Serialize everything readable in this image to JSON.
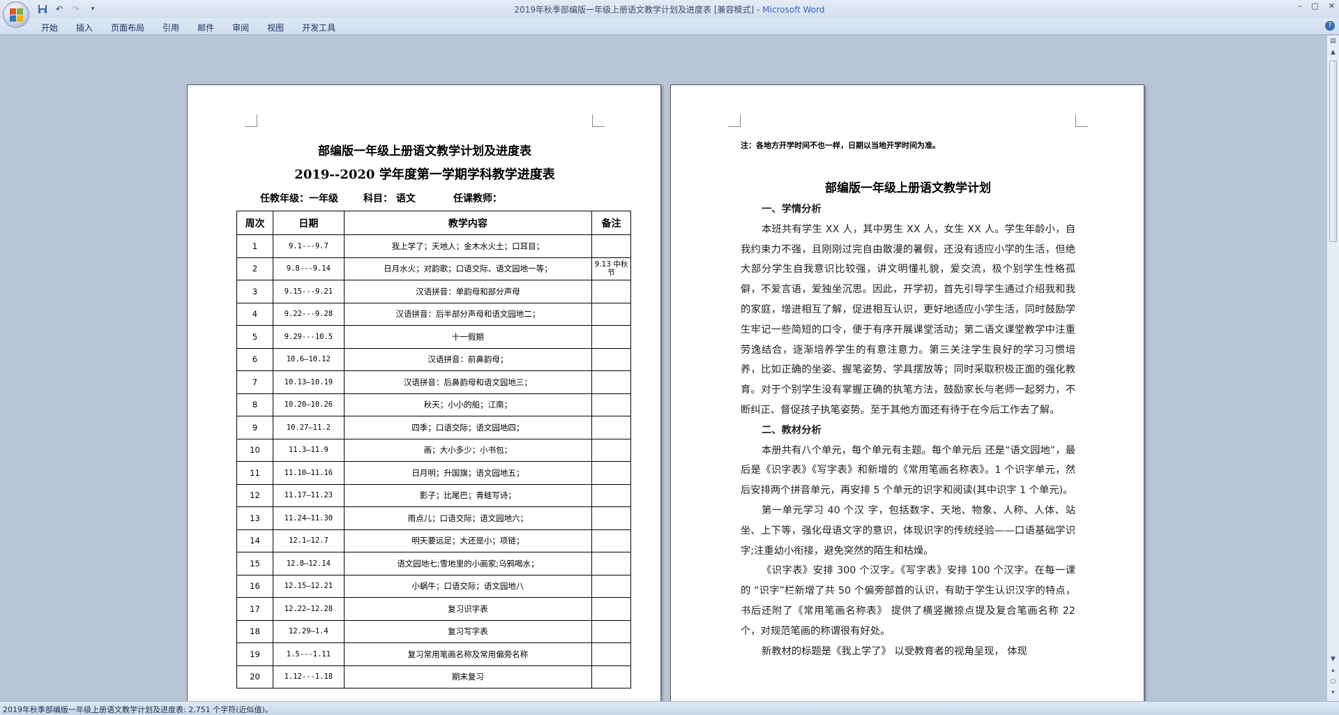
{
  "window": {
    "title": "2019年秋季部编版一年级上册语文教学计划及进度表 [兼容模式]",
    "app_name": "Microsoft Word",
    "controls": [
      "–",
      "□",
      "✕"
    ]
  },
  "ribbon": {
    "tabs": [
      "开始",
      "插入",
      "页面布局",
      "引用",
      "邮件",
      "审阅",
      "视图",
      "开发工具"
    ],
    "help": "?"
  },
  "page1": {
    "title": "部编版一年级上册语文教学计划及进度表",
    "subtitle": "2019--2020 学年度第一学期学科教学进度表",
    "info": {
      "grade": "任教年级：一年级",
      "subject": "科目： 语文",
      "teacher": "任课教师："
    },
    "table": {
      "headers": [
        "周次",
        "日期",
        "教学内容",
        "备注"
      ],
      "rows": [
        {
          "week": "1",
          "date": "9.1---9.7",
          "content": "我上学了；天地人；金木水火土；口耳目；",
          "remark": ""
        },
        {
          "week": "2",
          "date": "9.8---9.14",
          "content": "日月水火；对韵歌；口语交际、语文园地一等；",
          "remark": "9.13 中秋节"
        },
        {
          "week": "3",
          "date": "9.15---9.21",
          "content": "汉语拼音：单韵母和部分声母",
          "remark": ""
        },
        {
          "week": "4",
          "date": "9.22---9.28",
          "content": "汉语拼音：后半部分声母和语文园地二；",
          "remark": ""
        },
        {
          "week": "5",
          "date": "9.29---10.5",
          "content": "十一假期",
          "remark": ""
        },
        {
          "week": "6",
          "date": "10.6—10.12",
          "content": "汉语拼音：前鼻韵母；",
          "remark": ""
        },
        {
          "week": "7",
          "date": "10.13—10.19",
          "content": "汉语拼音：后鼻韵母和语文园地三；",
          "remark": ""
        },
        {
          "week": "8",
          "date": "10.20—10.26",
          "content": "秋天；小小的船；江南；",
          "remark": ""
        },
        {
          "week": "9",
          "date": "10.27—11.2",
          "content": "四季；口语交际；语文园地四；",
          "remark": ""
        },
        {
          "week": "10",
          "date": "11.3—11.9",
          "content": "画；大小多少；小书包；",
          "remark": ""
        },
        {
          "week": "11",
          "date": "11.10—11.16",
          "content": "日月明；升国旗；语文园地五；",
          "remark": ""
        },
        {
          "week": "12",
          "date": "11.17—11.23",
          "content": "影子；比尾巴；青蛙写诗；",
          "remark": ""
        },
        {
          "week": "13",
          "date": "11.24—11.30",
          "content": "雨点儿；口语交际；语文园地六；",
          "remark": ""
        },
        {
          "week": "14",
          "date": "12.1—12.7",
          "content": "明天要远足；大还是小；项链；",
          "remark": ""
        },
        {
          "week": "15",
          "date": "12.8—12.14",
          "content": "语文园地七;雪地里的小画家;乌鸦喝水；",
          "remark": ""
        },
        {
          "week": "16",
          "date": "12.15—12.21",
          "content": "小蜗牛；口语交际；语文园地八",
          "remark": ""
        },
        {
          "week": "17",
          "date": "12.22—12.28",
          "content": "复习识字表",
          "remark": ""
        },
        {
          "week": "18",
          "date": "12.29—1.4",
          "content": "复习写字表",
          "remark": ""
        },
        {
          "week": "19",
          "date": "1.5---1.11",
          "content": "复习常用笔画名称及常用偏旁名称",
          "remark": ""
        },
        {
          "week": "20",
          "date": "1.12---1.18",
          "content": "期末复习",
          "remark": ""
        }
      ]
    }
  },
  "page2": {
    "note": "注：各地方开学时间不也一样，日期以当地开学时间为准。",
    "title": "部编版一年级上册语文教学计划",
    "sections": [
      {
        "type": "heading",
        "text": "一、学情分析"
      },
      {
        "type": "para",
        "text": "本班共有学生 XX 人，其中男生 XX 人，女生 XX 人。学生年龄小，自我约束力不强，且刚刚过完自由散漫的暑假，还没有适应小学的生活，但绝大部分学生自我意识比较强，讲文明懂礼貌，爱交流，极个别学生性格孤僻，不爱言语，爱独坐沉思。因此，开学初，首先引导学生通过介绍我和我的家庭，增进相互了解，促进相互认识，更好地适应小学生活，同时鼓励学生牢记一些简短的口令，便于有序开展课堂活动；第二语文课堂教学中注重劳逸结合，逐渐培养学生的有意注意力。第三关注学生良好的学习习惯培养，比如正确的坐姿、握笔姿势、学具摆放等；同时采取积极正面的强化教育。对于个别学生没有掌握正确的执笔方法，鼓励家长与老师一起努力，不断纠正、督促孩子执笔姿势。至于其他方面还有待于在今后工作去了解。"
      },
      {
        "type": "heading",
        "text": "二、教材分析"
      },
      {
        "type": "para",
        "text": "本册共有八个单元，每个单元有主题。每个单元后 还是“语文园地”，最后是《识字表》《写字表》和新增的《常用笔画名称表》。1 个识字单元，然后安排两个拼音单元，再安排 5 个单元的识字和阅读(其中识字 1 个单元)。"
      },
      {
        "type": "para",
        "text": "第一单元学习 40 个汉 字，包括数字、天地、物象、人称、人体、站坐、上下等，强化母语文字的意识，体现识字的传统经验——口语基础学识字;注重幼小衔接，避免突然的陌生和枯燥。"
      },
      {
        "type": "para",
        "text": "《识字表》安排 300 个汉字。《写字表》安排 100 个汉字。在每一课的 “识字”栏新增了共 50 个偏旁部首的认识，有助于学生认识汉字的特点，书后还附了《常用笔画名称表》 提供了横竖撇捺点提及复合笔画名称 22 个，对规范笔画的称谓很有好处。"
      },
      {
        "type": "para",
        "text": "新教材的标题是《我上学了》 以受教育者的视角呈现， 体现"
      }
    ]
  },
  "statusbar": {
    "text": "2019年秋季部编版一年级上册语文教学计划及进度表: 2,751 个字符(近似值)。"
  },
  "colors": {
    "workspace": "#b8c5d6",
    "ribbon": "#d8e4f2",
    "accent": "#3a6ab0"
  }
}
